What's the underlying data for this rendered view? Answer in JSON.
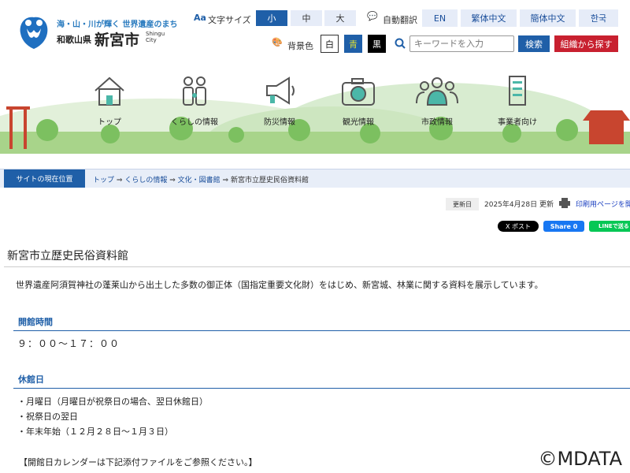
{
  "header": {
    "tagline": "海・山・川が輝く 世界遺産のまち",
    "prefecture": "和歌山県",
    "city": "新宮市",
    "city_en_1": "Shingu",
    "city_en_2": "City",
    "font_size_label": "文字サイズ",
    "font_sizes": [
      "小",
      "中",
      "大"
    ],
    "translate_label": "自動翻訳",
    "languages": [
      "EN",
      "繁体中文",
      "簡体中文",
      "한국"
    ],
    "bg_color_label": "背景色",
    "bg_colors": [
      "白",
      "青",
      "黒"
    ],
    "search_placeholder": "キーワードを入力",
    "search_button": "検索",
    "org_button": "組織から探す"
  },
  "nav": [
    {
      "label": "トップ",
      "icon": "house-icon"
    },
    {
      "label": "くらしの情報",
      "icon": "family-icon"
    },
    {
      "label": "防災情報",
      "icon": "megaphone-icon"
    },
    {
      "label": "観光情報",
      "icon": "camera-icon"
    },
    {
      "label": "市政情報",
      "icon": "people-icon"
    },
    {
      "label": "事業者向け",
      "icon": "building-icon"
    }
  ],
  "breadcrumb": {
    "here_label": "サイトの現在位置",
    "items": [
      "トップ",
      "くらしの情報",
      "文化・図書館"
    ],
    "current": "新宮市立歴史民俗資料館",
    "sep": "⇒"
  },
  "meta": {
    "updated_label": "更新日",
    "updated": "2025年4月28日 更新",
    "print": "印刷用ページを開く",
    "x_post": "X ポスト",
    "fb_share": "Share 0",
    "line": "LINEで送る"
  },
  "page": {
    "title": "新宮市立歴史民俗資料館",
    "intro": "世界遺産阿須賀神社の蓬莱山から出土した多数の御正体（国指定重要文化財）をはじめ、新宮城、林業に関する資料を展示しています。",
    "hours_heading": "開館時間",
    "hours": "９：００～１７：００",
    "closed_heading": "休館日",
    "closed": [
      "・月曜日（月曜日が祝祭日の場合、翌日休館日）",
      "・祝祭日の翌日",
      "・年末年始（１２月２８日～１月３日）"
    ],
    "calendar_note": "【開館日カレンダーは下記添付ファイルをご参照ください。】"
  },
  "watermark": "©MDATA",
  "colors": {
    "primary": "#1f5fa8",
    "red": "#c8202f",
    "light": "#e6ecf8"
  }
}
